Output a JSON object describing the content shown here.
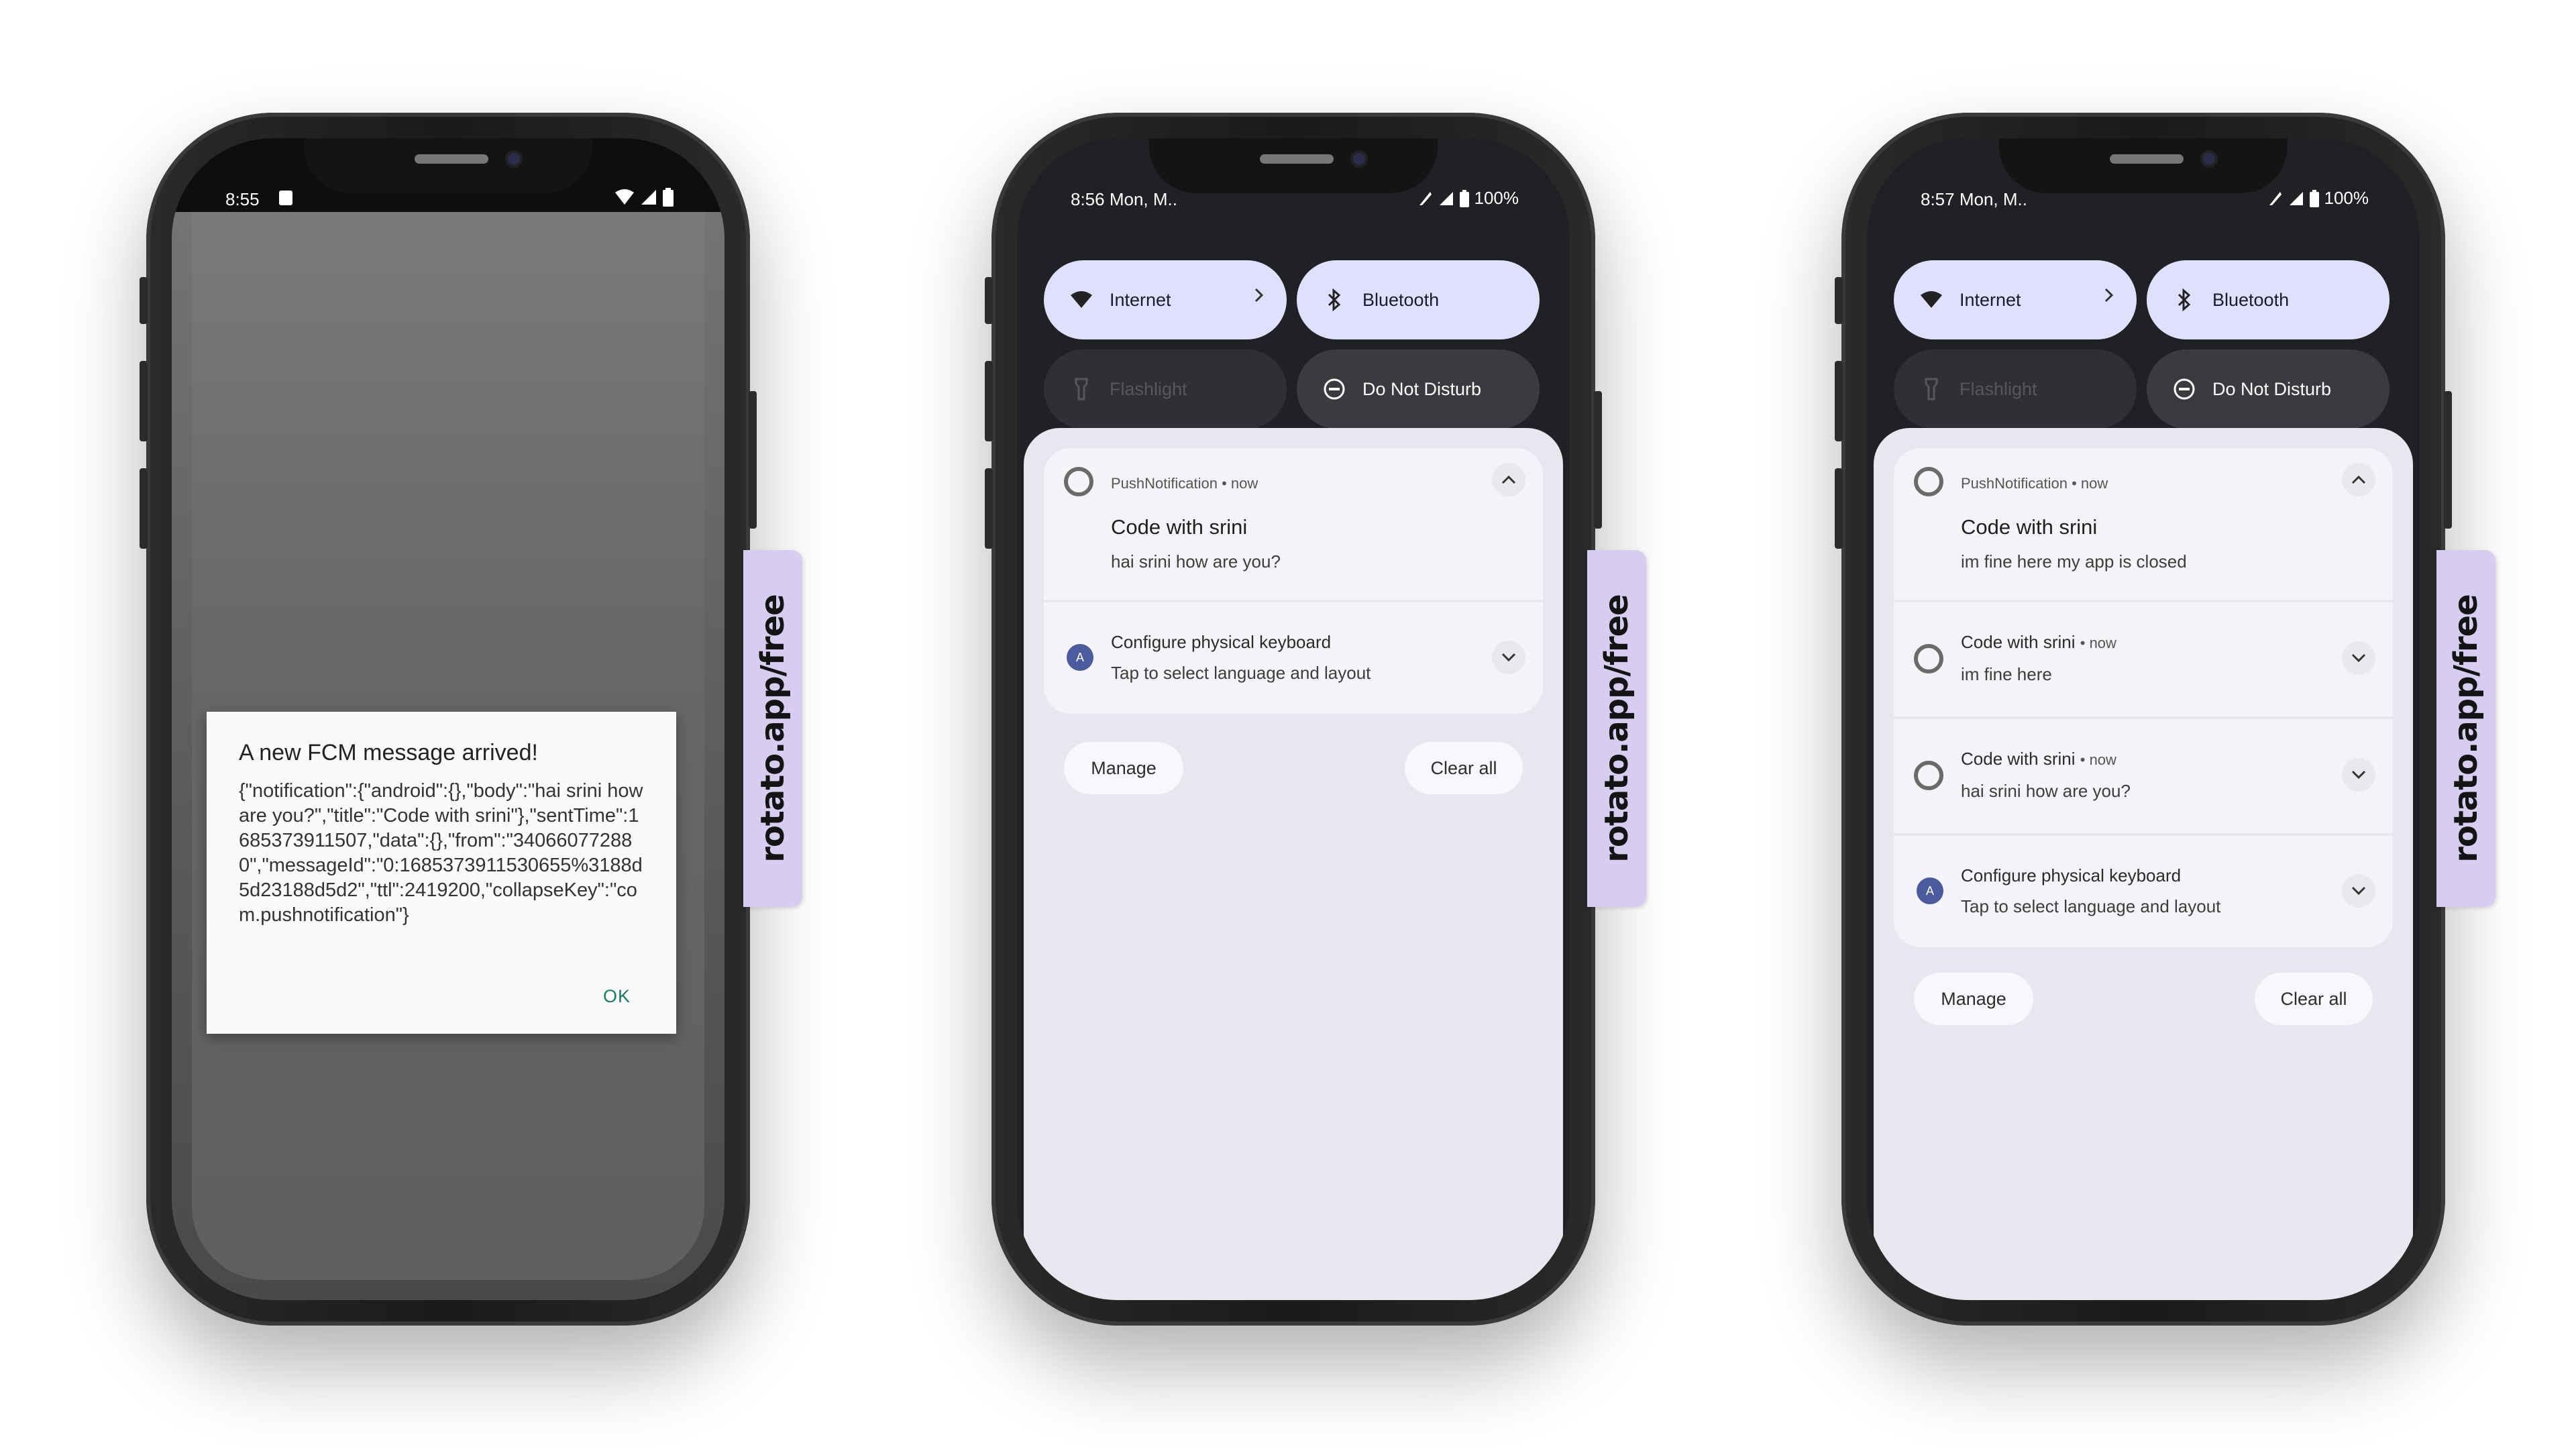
{
  "watermark": "rotato.app/free",
  "phone1": {
    "status_time": "8:55",
    "dialog": {
      "title": "A new FCM message arrived!",
      "body": "{\"notification\":{\"android\":{},\"body\":\"hai srini how are you?\",\"title\":\"Code with srini\"},\"sentTime\":1685373911507,\"data\":{},\"from\":\"340660772880\",\"messageId\":\"0:1685373911530655%3188d5d23188d5d2\",\"ttl\":2419200,\"collapseKey\":\"com.pushnotification\"}",
      "ok_label": "OK"
    }
  },
  "phone2": {
    "status_time": "8:56 Mon, M..",
    "battery": "100%",
    "tiles": {
      "internet": "Internet",
      "bluetooth": "Bluetooth",
      "flashlight": "Flashlight",
      "dnd": "Do Not Disturb"
    },
    "notif_main": {
      "app": "PushNotification • now",
      "title": "Code with srini",
      "text": "hai srini how are you?"
    },
    "notif_keyboard": {
      "title": "Configure physical keyboard",
      "text": "Tap to select language and layout"
    },
    "manage_label": "Manage",
    "clear_label": "Clear all"
  },
  "phone3": {
    "status_time": "8:57 Mon, M..",
    "battery": "100%",
    "tiles": {
      "internet": "Internet",
      "bluetooth": "Bluetooth",
      "flashlight": "Flashlight",
      "dnd": "Do Not Disturb"
    },
    "notif_main": {
      "app": "PushNotification • now",
      "title": "Code with srini",
      "text": "im fine here my app is closed"
    },
    "notif_a": {
      "title": "Code with srini",
      "now": "• now",
      "text": "im fine here"
    },
    "notif_b": {
      "title": "Code with srini",
      "now": "• now",
      "text": "hai srini how are you?"
    },
    "notif_keyboard": {
      "title": "Configure physical keyboard",
      "text": "Tap to select language and layout"
    },
    "manage_label": "Manage",
    "clear_label": "Clear all"
  }
}
